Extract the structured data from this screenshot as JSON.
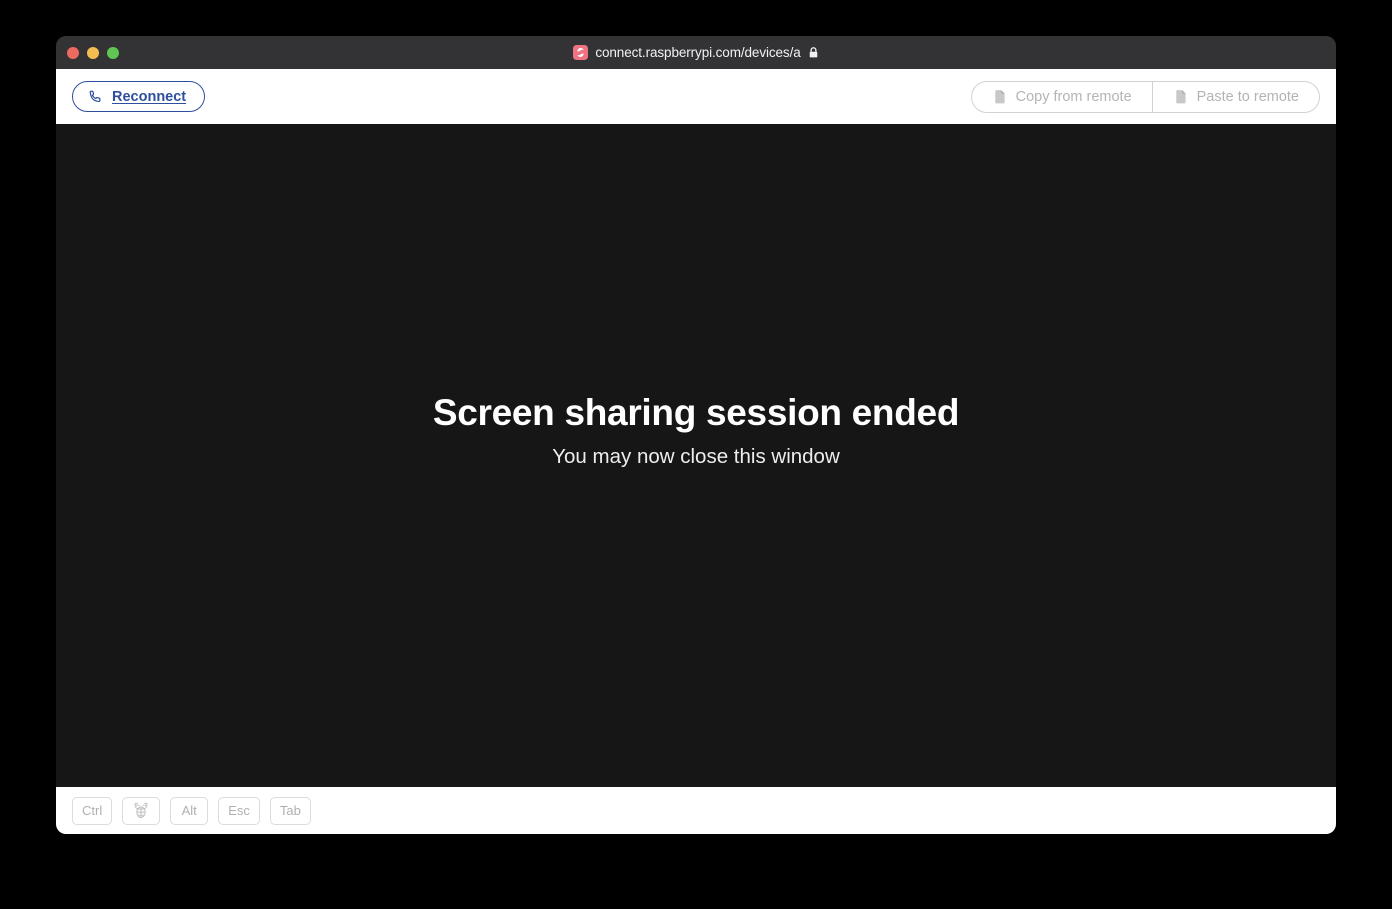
{
  "window": {
    "title_bar": {
      "url": "connect.raspberrypi.com/devices/a",
      "lock_glyph": "🔒",
      "favicon_name": "raspberry-pi-connect-favicon",
      "traffic_lights": [
        {
          "name": "close",
          "color": "#ED6A5E"
        },
        {
          "name": "minimize",
          "color": "#F4BD4F"
        },
        {
          "name": "maximize",
          "color": "#61C554"
        }
      ]
    },
    "toolbar": {
      "reconnect_label": "Reconnect",
      "reconnect_icon": "phone-icon",
      "reconnect_color": "#2E4F9E",
      "clipboard_buttons": [
        {
          "label": "Copy from remote",
          "icon": "copy-icon",
          "enabled": false
        },
        {
          "label": "Paste to remote",
          "icon": "paste-icon",
          "enabled": false
        }
      ],
      "disabled_color": "#B4B4B4"
    },
    "remote_screen": {
      "background": "#161616",
      "heading": "Screen sharing session ended",
      "subtext": "You may now close this window"
    },
    "key_bar": {
      "keys": [
        {
          "label": "Ctrl",
          "icon": null
        },
        {
          "label": "",
          "icon": "raspberry-pi-icon"
        },
        {
          "label": "Alt",
          "icon": null
        },
        {
          "label": "Esc",
          "icon": null
        },
        {
          "label": "Tab",
          "icon": null
        }
      ]
    }
  }
}
